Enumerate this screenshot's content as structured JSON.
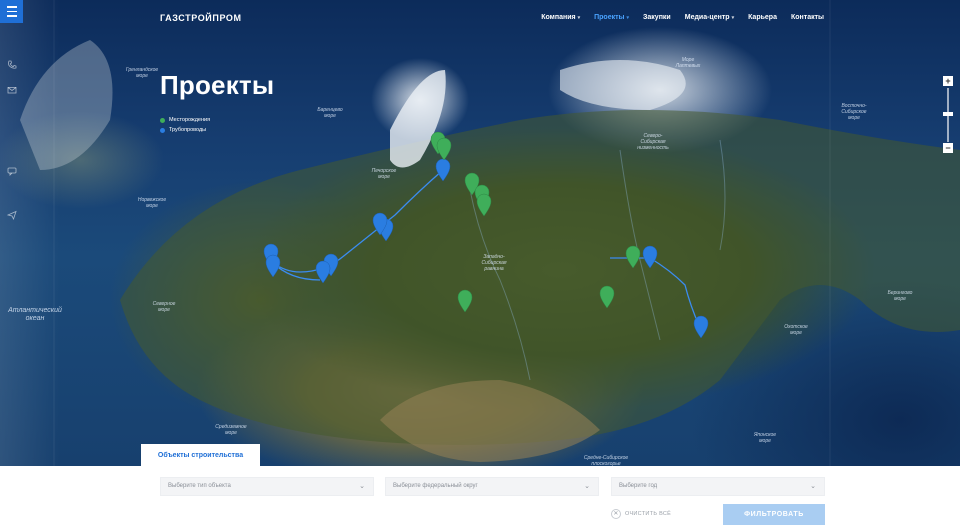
{
  "header": {
    "logo": "ГАЗСТРОЙПРОМ",
    "nav": [
      {
        "label": "Компания",
        "has_dropdown": true,
        "active": false
      },
      {
        "label": "Проекты",
        "has_dropdown": true,
        "active": true
      },
      {
        "label": "Закупки",
        "has_dropdown": false,
        "active": false
      },
      {
        "label": "Медиа-центр",
        "has_dropdown": true,
        "active": false
      },
      {
        "label": "Карьера",
        "has_dropdown": false,
        "active": false
      },
      {
        "label": "Контакты",
        "has_dropdown": false,
        "active": false
      }
    ],
    "caret": "▾"
  },
  "side_icons": [
    "phone-icon",
    "mail-icon",
    "chat-icon",
    "send-icon"
  ],
  "page": {
    "title": "Проекты"
  },
  "legend": [
    {
      "label": "Месторождения",
      "color": "#3fae5a"
    },
    {
      "label": "Трубопроводы",
      "color": "#2a7de1"
    }
  ],
  "map": {
    "sea_labels": [
      {
        "text": "Гренландское\nморе"
      },
      {
        "text": "Баренцево\nморе"
      },
      {
        "text": "Печорское\nморе"
      },
      {
        "text": "Норвежское\nморе"
      },
      {
        "text": "Северное\nморе"
      },
      {
        "text": "Море\nЛаптевых"
      },
      {
        "text": "Восточно-\nСибирское\nморе"
      },
      {
        "text": "Атлантический\nокеан"
      },
      {
        "text": "Западно-\nСибирская\nравнина"
      },
      {
        "text": "Северо-\nСибирская\nнизменность"
      },
      {
        "text": "Охотское\nморе"
      },
      {
        "text": "Берингово\nморе"
      },
      {
        "text": "Японское\nморе"
      },
      {
        "text": "Средиземное\nморе"
      },
      {
        "text": "Средне-Сибирское\nплоскогорье"
      }
    ],
    "zoom": {
      "plus": "+",
      "minus": "−"
    }
  },
  "filters": {
    "tab_label": "Объекты строительства",
    "type_placeholder": "Выберите тип объекта",
    "district_placeholder": "Выберите федеральный округ",
    "year_placeholder": "Выберите год",
    "clear_label": "ОЧИСТИТЬ ВСЁ",
    "submit_label": "ФИЛЬТРОВАТЬ",
    "chevron": "⌄",
    "clear_icon": "✕"
  }
}
